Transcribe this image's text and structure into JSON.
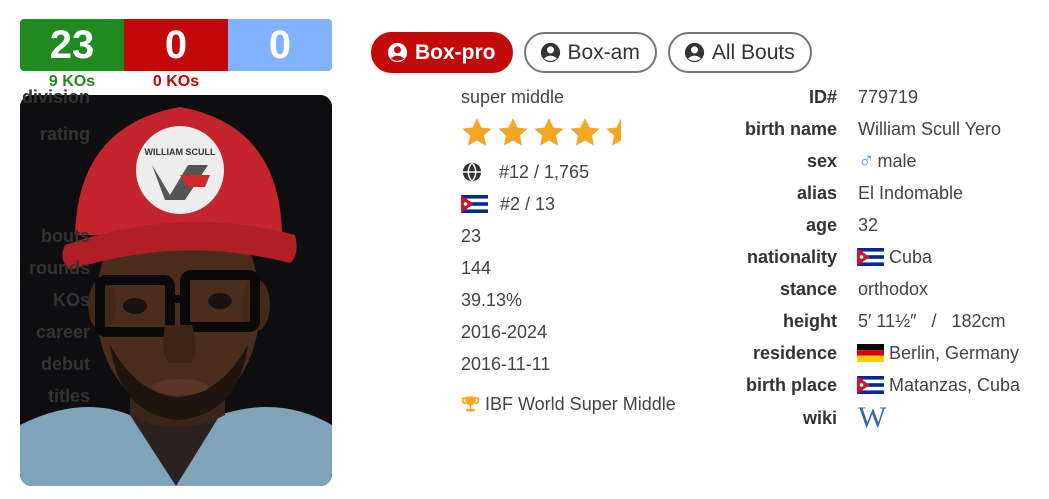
{
  "record": {
    "wins": "23",
    "losses": "0",
    "draws": "0",
    "win_kos": "9 KOs",
    "loss_kos": "0 KOs"
  },
  "tabs": [
    {
      "label": "Box-pro",
      "active": true
    },
    {
      "label": "Box-am",
      "active": false
    },
    {
      "label": "All Bouts",
      "active": false
    }
  ],
  "left": {
    "division_label": "division",
    "division": "super middle",
    "rating_label": "rating",
    "rating_stars": 4.5,
    "world_rank": "#12 / 1,765",
    "country_rank": "#2 / 13",
    "bouts_label": "bouts",
    "bouts": "23",
    "rounds_label": "rounds",
    "rounds": "144",
    "kos_label": "KOs",
    "kos": "39.13%",
    "career_label": "career",
    "career": "2016-2024",
    "debut_label": "debut",
    "debut": "2016-11-11",
    "titles_label": "titles",
    "titles": "IBF World Super Middle"
  },
  "right": {
    "id_label": "ID#",
    "id": "779719",
    "birthname_label": "birth name",
    "birthname": "William Scull Yero",
    "sex_label": "sex",
    "sex": "male",
    "alias_label": "alias",
    "alias": "El Indomable",
    "age_label": "age",
    "age": "32",
    "nationality_label": "nationality",
    "nationality": "Cuba",
    "stance_label": "stance",
    "stance": "orthodox",
    "height_label": "height",
    "height": "5′ 11½″   /   182cm",
    "residence_label": "residence",
    "residence": "Berlin, Germany",
    "birthplace_label": "birth place",
    "birthplace": "Matanzas, Cuba",
    "wiki_label": "wiki",
    "wiki": "W"
  },
  "photo": {
    "cap_text": "WILLIAM SCULL"
  },
  "colors": {
    "win": "#1f8a1f",
    "loss": "#c20808",
    "draw": "#82b1ff",
    "star": "#f5a623",
    "active_tab": "#c20a0a"
  }
}
